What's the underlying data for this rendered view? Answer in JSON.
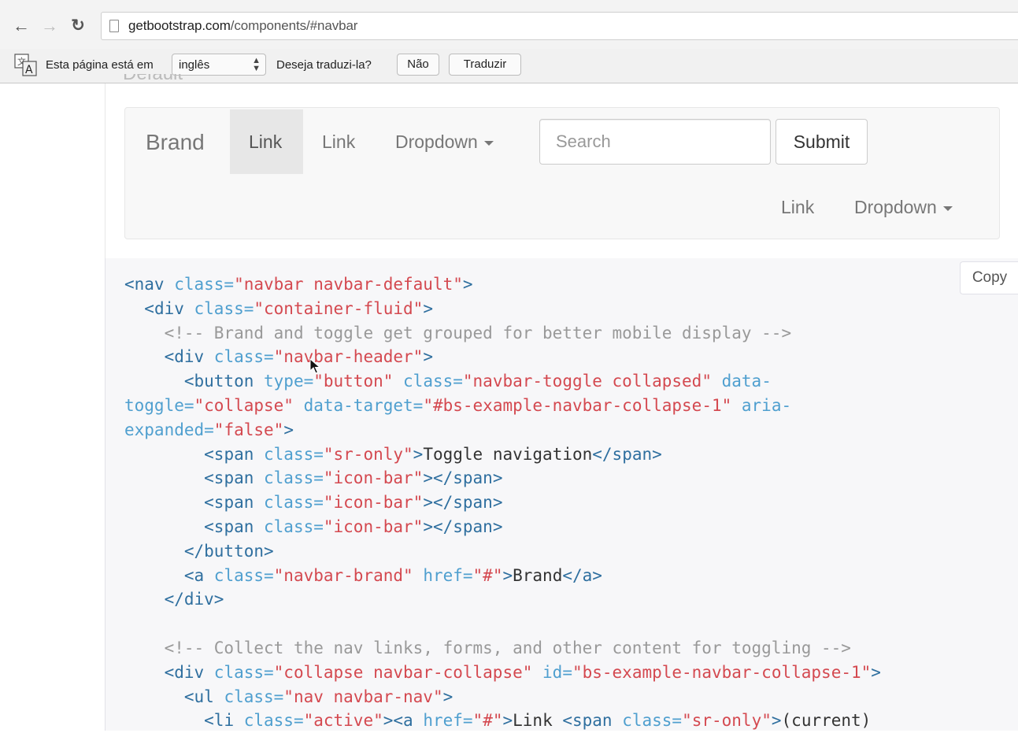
{
  "browser": {
    "url_host": "getbootstrap.com",
    "url_path": "/components/#navbar",
    "translate_bar": {
      "prompt": "Esta página está em",
      "language": "inglês",
      "question": "Deseja traduzi-la?",
      "no_label": "Não",
      "translate_label": "Traduzir"
    }
  },
  "example": {
    "clipped_heading": "Default",
    "brand": "Brand",
    "link_active": "Link",
    "link": "Link",
    "dropdown": "Dropdown",
    "search_placeholder": "Search",
    "submit": "Submit",
    "link2": "Link",
    "dropdown2": "Dropdown"
  },
  "code": {
    "copy_label": "Copy",
    "lines": [
      [
        [
          "t",
          "<nav "
        ],
        [
          "a",
          "class="
        ],
        [
          "s",
          "\"navbar navbar-default\""
        ],
        [
          "t",
          ">"
        ]
      ],
      [
        [
          "x",
          "  "
        ],
        [
          "t",
          "<div "
        ],
        [
          "a",
          "class="
        ],
        [
          "s",
          "\"container-fluid\""
        ],
        [
          "t",
          ">"
        ]
      ],
      [
        [
          "x",
          "    "
        ],
        [
          "c",
          "<!-- Brand and toggle get grouped for better mobile display -->"
        ]
      ],
      [
        [
          "x",
          "    "
        ],
        [
          "t",
          "<div "
        ],
        [
          "a",
          "class="
        ],
        [
          "s",
          "\"navbar-header\""
        ],
        [
          "t",
          ">"
        ]
      ],
      [
        [
          "x",
          "      "
        ],
        [
          "t",
          "<button "
        ],
        [
          "a",
          "type="
        ],
        [
          "s",
          "\"button\" "
        ],
        [
          "a",
          "class="
        ],
        [
          "s",
          "\"navbar-toggle collapsed\" "
        ],
        [
          "a",
          "data-"
        ]
      ],
      [
        [
          "a",
          "toggle="
        ],
        [
          "s",
          "\"collapse\" "
        ],
        [
          "a",
          "data-target="
        ],
        [
          "s",
          "\"#bs-example-navbar-collapse-1\" "
        ],
        [
          "a",
          "aria-"
        ]
      ],
      [
        [
          "a",
          "expanded="
        ],
        [
          "s",
          "\"false\""
        ],
        [
          "t",
          ">"
        ]
      ],
      [
        [
          "x",
          "        "
        ],
        [
          "t",
          "<span "
        ],
        [
          "a",
          "class="
        ],
        [
          "s",
          "\"sr-only\""
        ],
        [
          "t",
          ">"
        ],
        [
          "x",
          "Toggle navigation"
        ],
        [
          "t",
          "</span>"
        ]
      ],
      [
        [
          "x",
          "        "
        ],
        [
          "t",
          "<span "
        ],
        [
          "a",
          "class="
        ],
        [
          "s",
          "\"icon-bar\""
        ],
        [
          "t",
          "></span>"
        ]
      ],
      [
        [
          "x",
          "        "
        ],
        [
          "t",
          "<span "
        ],
        [
          "a",
          "class="
        ],
        [
          "s",
          "\"icon-bar\""
        ],
        [
          "t",
          "></span>"
        ]
      ],
      [
        [
          "x",
          "        "
        ],
        [
          "t",
          "<span "
        ],
        [
          "a",
          "class="
        ],
        [
          "s",
          "\"icon-bar\""
        ],
        [
          "t",
          "></span>"
        ]
      ],
      [
        [
          "x",
          "      "
        ],
        [
          "t",
          "</button>"
        ]
      ],
      [
        [
          "x",
          "      "
        ],
        [
          "t",
          "<a "
        ],
        [
          "a",
          "class="
        ],
        [
          "s",
          "\"navbar-brand\" "
        ],
        [
          "a",
          "href="
        ],
        [
          "s",
          "\"#\""
        ],
        [
          "t",
          ">"
        ],
        [
          "x",
          "Brand"
        ],
        [
          "t",
          "</a>"
        ]
      ],
      [
        [
          "x",
          "    "
        ],
        [
          "t",
          "</div>"
        ]
      ],
      [],
      [
        [
          "x",
          "    "
        ],
        [
          "c",
          "<!-- Collect the nav links, forms, and other content for toggling -->"
        ]
      ],
      [
        [
          "x",
          "    "
        ],
        [
          "t",
          "<div "
        ],
        [
          "a",
          "class="
        ],
        [
          "s",
          "\"collapse navbar-collapse\" "
        ],
        [
          "a",
          "id="
        ],
        [
          "s",
          "\"bs-example-navbar-collapse-1\""
        ],
        [
          "t",
          ">"
        ]
      ],
      [
        [
          "x",
          "      "
        ],
        [
          "t",
          "<ul "
        ],
        [
          "a",
          "class="
        ],
        [
          "s",
          "\"nav navbar-nav\""
        ],
        [
          "t",
          ">"
        ]
      ],
      [
        [
          "x",
          "        "
        ],
        [
          "t",
          "<li "
        ],
        [
          "a",
          "class="
        ],
        [
          "s",
          "\"active\""
        ],
        [
          "t",
          "><a "
        ],
        [
          "a",
          "href="
        ],
        [
          "s",
          "\"#\""
        ],
        [
          "t",
          ">"
        ],
        [
          "x",
          "Link "
        ],
        [
          "t",
          "<span "
        ],
        [
          "a",
          "class="
        ],
        [
          "s",
          "\"sr-only\""
        ],
        [
          "t",
          ">"
        ],
        [
          "x",
          "(current)"
        ]
      ]
    ]
  }
}
